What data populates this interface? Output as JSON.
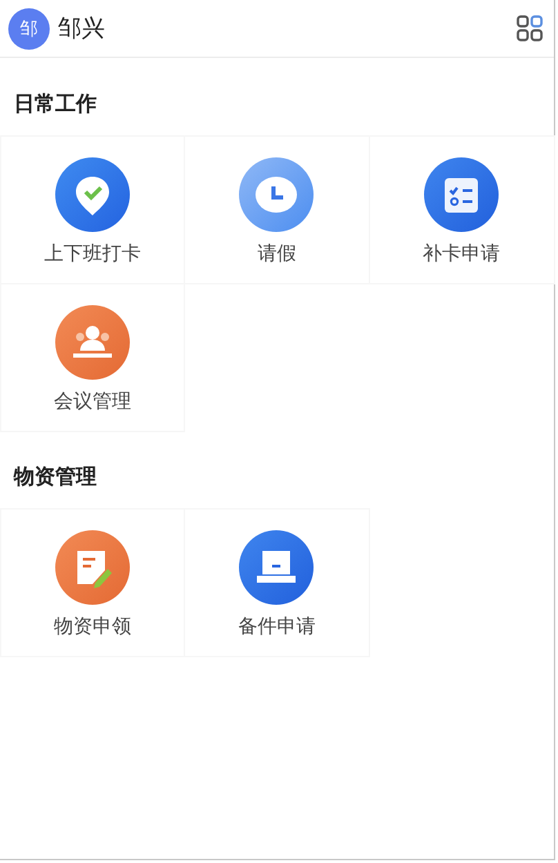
{
  "header": {
    "avatar": "邹",
    "name": "邹兴"
  },
  "sections": [
    {
      "title": "日常工作",
      "items": [
        {
          "label": "上下班打卡",
          "kind": "pin"
        },
        {
          "label": "请假",
          "kind": "clock"
        },
        {
          "label": "补卡申请",
          "kind": "checklist"
        },
        {
          "label": "会议管理",
          "kind": "meeting"
        }
      ]
    },
    {
      "title": "物资管理",
      "items": [
        {
          "label": "物资申领",
          "kind": "note"
        },
        {
          "label": "备件申请",
          "kind": "laptop"
        }
      ]
    }
  ]
}
